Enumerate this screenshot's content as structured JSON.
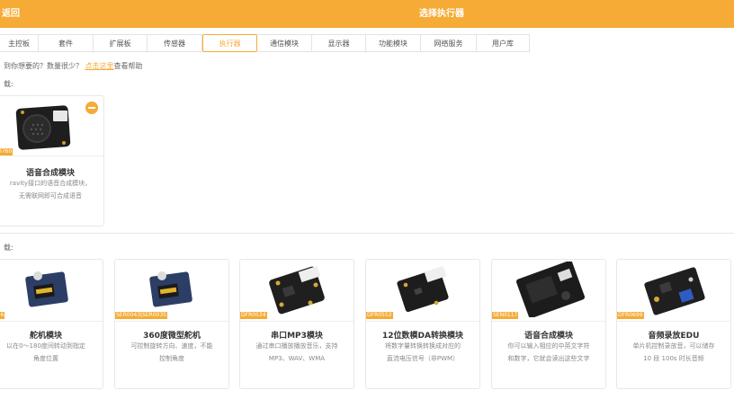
{
  "header": {
    "back_label": "返回",
    "title": "选择执行器"
  },
  "tabs": [
    {
      "label": "主控板"
    },
    {
      "label": "套件"
    },
    {
      "label": "扩展板"
    },
    {
      "label": "传感器"
    },
    {
      "label": "执行器",
      "active": true
    },
    {
      "label": "通信模块"
    },
    {
      "label": "显示器"
    },
    {
      "label": "功能模块"
    },
    {
      "label": "网络服务"
    },
    {
      "label": "用户库"
    }
  ],
  "hint": {
    "prefix": "到你想要的？数量很少？",
    "link": "点击这里",
    "suffix": "查看帮助"
  },
  "selected": {
    "label": "载:",
    "item": {
      "sku": "0760",
      "name": "语音合成模块",
      "desc1": "ravity接口的语音合成模块，",
      "desc2": "无需联网即可合成语音",
      "icon": "minus-circle-icon"
    }
  },
  "available": {
    "label": "载:",
    "items": [
      {
        "sku": "0006",
        "name": "舵机模块",
        "desc1": "以在0～180度间转动到指定",
        "desc2": "角度位置"
      },
      {
        "sku": "SER0043|SER0035",
        "name": "360度微型舵机",
        "desc1": "可控制旋转方向、速度，不能",
        "desc2": "控制角度"
      },
      {
        "sku": "DFR0534",
        "name": "串口MP3模块",
        "desc1": "通过串口播放播放音乐，支持",
        "desc2": "MP3、WAV、WMA"
      },
      {
        "sku": "DFR0552",
        "name": "12位数模DA转换模块",
        "desc1": "将数字量转换转换成对应的",
        "desc2": "直流电压信号（非PWM）"
      },
      {
        "sku": "SEN0117",
        "name": "语音合成模块",
        "desc1": "你可以输入相应的中英文字符",
        "desc2": "和数字，它就会读出这些文字"
      },
      {
        "sku": "DFR0699",
        "name": "音频录放EDU",
        "desc1": "单片机控制录放音，可以储存",
        "desc2": "10 段 100s 时长音频"
      }
    ]
  },
  "colors": {
    "accent": "#f5ab35",
    "text": "#333333",
    "muted": "#888888"
  }
}
